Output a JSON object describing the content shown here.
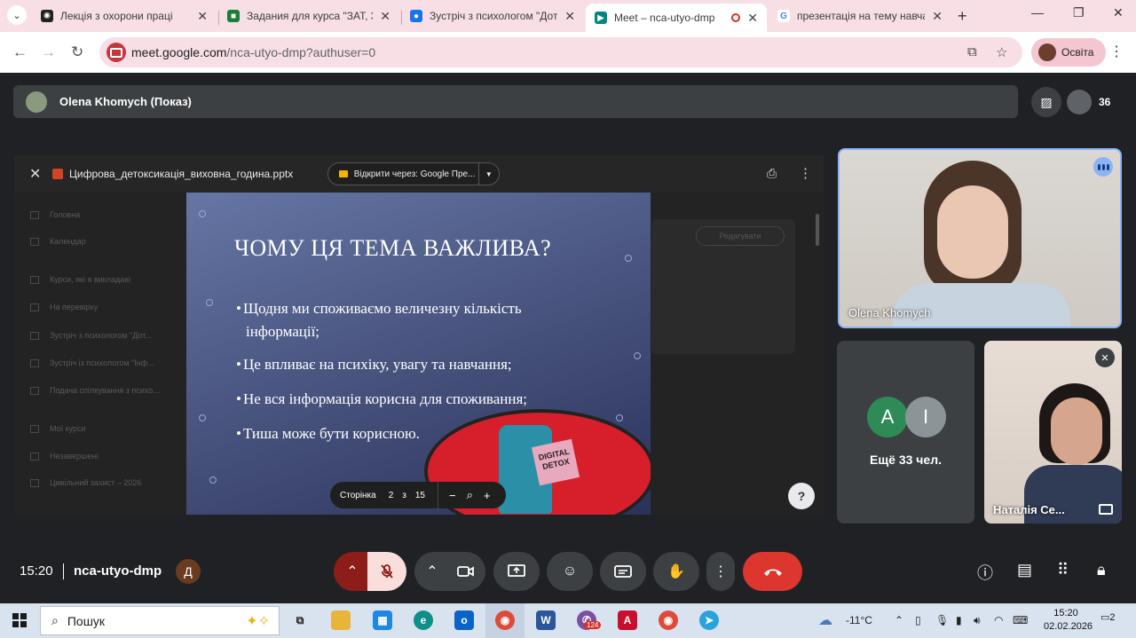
{
  "browser": {
    "tabs": [
      {
        "title": "Лекція з охорони праці",
        "favicon": "openai-icon",
        "color": "#202124"
      },
      {
        "title": "Задания для курса \"ЗАТ, ЗА",
        "favicon": "classroom-icon",
        "color": "#188038"
      },
      {
        "title": "Зустріч з психологом \"Дотр",
        "favicon": "classroom-person-icon",
        "color": "#1a73e8"
      },
      {
        "title": "Meet – nca-utyo-dmp",
        "favicon": "meet-icon",
        "color": "#00897b"
      },
      {
        "title": "презентація на тему навчал",
        "favicon": "google-icon",
        "color": "#4285f4"
      }
    ],
    "url_host": "meet.google.com",
    "url_path": "/nca-utyo-dmp?authuser=0",
    "profile_label": "Освіта"
  },
  "meet": {
    "presenter_label": "Olena Khomych (Показ)",
    "participants_count": "36",
    "viewer": {
      "file_name": "Цифрова_детоксикація_виховна_година.pptx",
      "open_with": "Відкрити через: Google Пре...",
      "background_sidebar": [
        "Головна",
        "Календар",
        "Курси, які я викладаю",
        "На перевірку",
        "Зустріч з психологом \"Дот...",
        "Зустріч із психологом \"Інф...",
        "Подача спілкування з психо...",
        "Мої курси",
        "Незавершені",
        "Цивільний захист – 2026"
      ],
      "background_button": "Редагувати",
      "slide": {
        "title": "ЧОМУ ЦЯ ТЕМА ВАЖЛИВА?",
        "bullets": [
          {
            "line1": "Щодня ми споживаємо величезну кількість",
            "line2": "інформації;"
          },
          {
            "line1": "Це впливає на психіку, увагу та навчання;",
            "line2": ""
          },
          {
            "line1": "Не вся інформація корисна для споживання;",
            "line2": ""
          },
          {
            "line1": "Тиша може бути корисною.",
            "line2": ""
          }
        ],
        "art_text_1": "DIGITAL",
        "art_text_2": "DETOX"
      },
      "pager": {
        "label": "Сторінка",
        "current": "2",
        "of": "з",
        "total": "15"
      }
    },
    "tiles": {
      "main_name": "Olena Khomych",
      "more_initials": [
        "A",
        "I"
      ],
      "more_label": "Ещё 33 чел.",
      "other_name": "Наталія Се..."
    },
    "bottom": {
      "time": "15:20",
      "code": "nca-utyo-dmp"
    }
  },
  "taskbar": {
    "search_placeholder": "Пошук",
    "weather": "-11°C",
    "time": "15:20",
    "date": "02.02.2026",
    "notifications": "2",
    "viber_badge": "124"
  },
  "colors": {
    "meet_bg": "#202124",
    "tab_strip": "#f7dfe5",
    "hangup": "#dc362e",
    "speaking": "#8ab4f8"
  }
}
